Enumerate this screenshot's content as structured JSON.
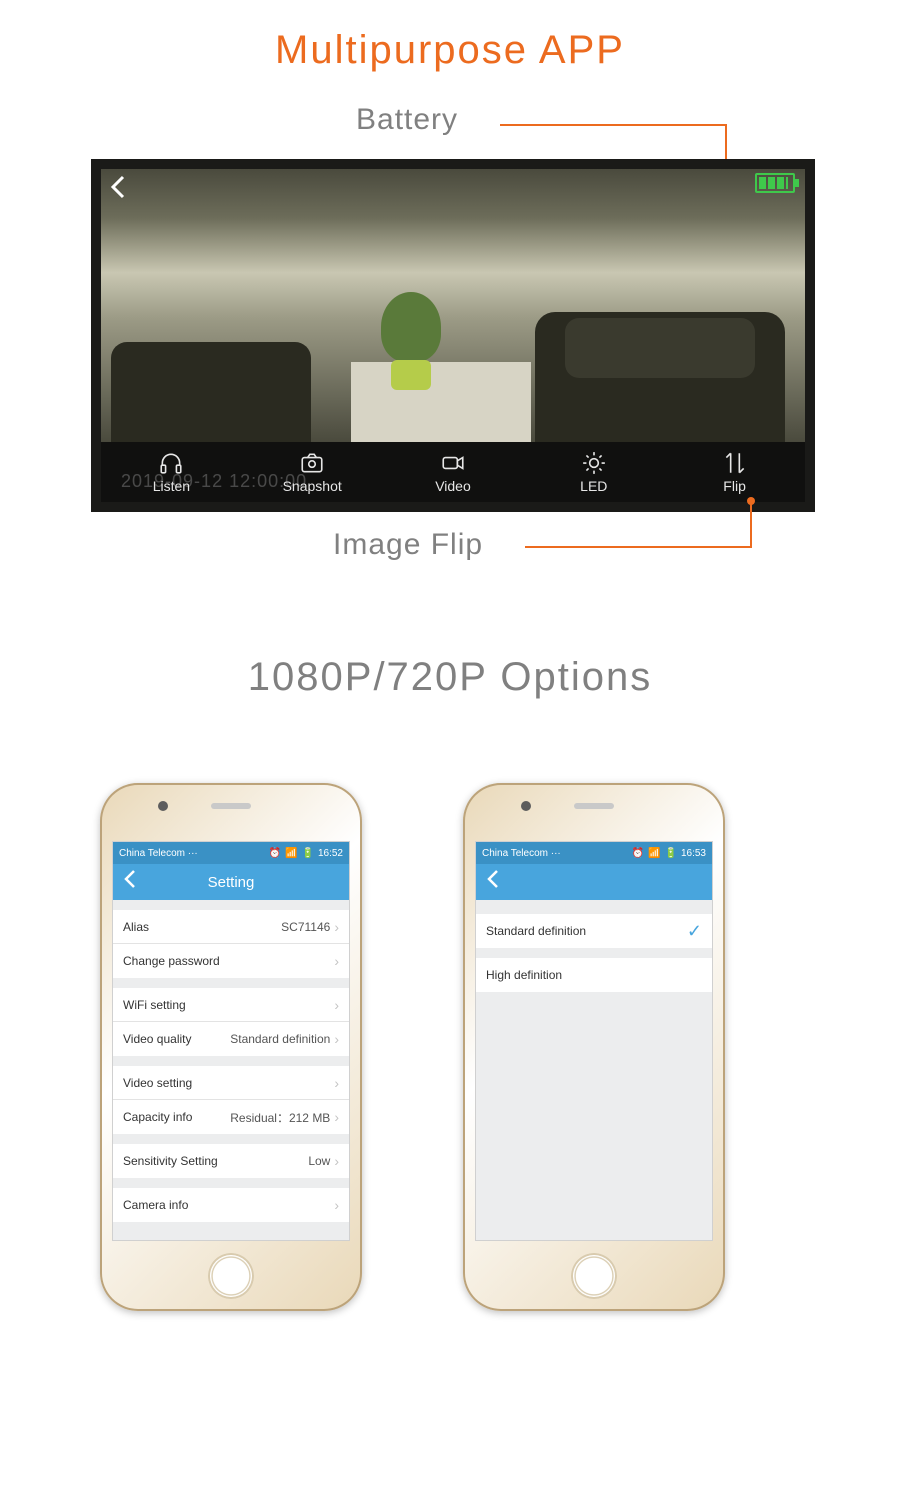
{
  "titles": {
    "main": "Multipurpose APP",
    "section2": "1080P/720P Options"
  },
  "callouts": {
    "battery": "Battery",
    "flip": "Image Flip"
  },
  "viewer": {
    "timestamp": "2019-09-12 12:00:00",
    "buttons": {
      "listen": "Listen",
      "snapshot": "Snapshot",
      "video": "Video",
      "led": "LED",
      "flip": "Flip"
    }
  },
  "statusbar": {
    "carrier": "China Telecom ···",
    "time_left": "16:52",
    "time_right": "16:53"
  },
  "settings": {
    "title": "Setting",
    "alias_label": "Alias",
    "alias_value": "SC71146",
    "change_password": "Change password",
    "wifi": "WiFi setting",
    "video_quality_label": "Video quality",
    "video_quality_value": "Standard definition",
    "video_setting": "Video setting",
    "capacity_label": "Capacity info",
    "capacity_value": "Residual：212 MB",
    "sensitivity_label": "Sensitivity Setting",
    "sensitivity_value": "Low",
    "camera_info": "Camera info"
  },
  "resolution_options": {
    "standard": "Standard definition",
    "high": "High definition"
  }
}
